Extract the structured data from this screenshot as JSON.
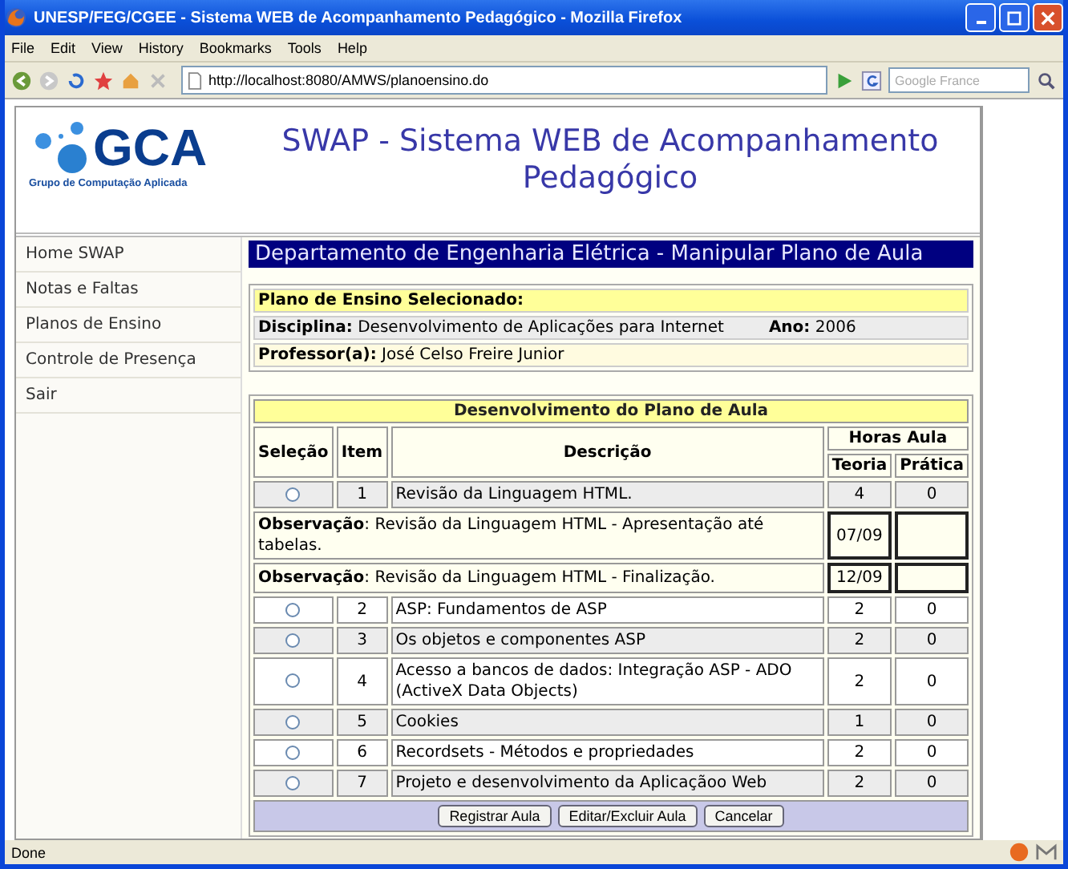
{
  "window": {
    "title": "UNESP/FEG/CGEE - Sistema WEB de Acompanhamento Pedagógico - Mozilla Firefox"
  },
  "menu": [
    "File",
    "Edit",
    "View",
    "History",
    "Bookmarks",
    "Tools",
    "Help"
  ],
  "toolbar": {
    "url": "http://localhost:8080/AMWS/planoensino.do",
    "search_placeholder": "Google France"
  },
  "header": {
    "logo_text": "GCA",
    "logo_subtitle": "Grupo de Computação Aplicada",
    "title": "SWAP - Sistema WEB de Acompanhamento Pedagógico"
  },
  "sidebar": {
    "items": [
      {
        "label": "Home SWAP",
        "selected": false
      },
      {
        "label": "Notas e Faltas",
        "selected": false
      },
      {
        "label": "Planos de Ensino",
        "selected": false
      },
      {
        "label": "Controle de Presença",
        "selected": false
      },
      {
        "label": "Sair",
        "selected": false
      }
    ]
  },
  "section_title": "Departamento de Engenharia Elétrica - Manipular Plano de Aula",
  "plan_info": {
    "title": "Plano de Ensino Selecionado:",
    "discipline_label": "Disciplina:",
    "discipline": "Desenvolvimento de Aplicações para Internet",
    "year_label": "Ano:",
    "year": "2006",
    "professor_label": "Professor(a):",
    "professor": "José Celso Freire Junior"
  },
  "table": {
    "title": "Desenvolvimento do Plano de Aula",
    "columns": {
      "selection": "Seleção",
      "item": "Item",
      "description": "Descrição",
      "hours": "Horas Aula",
      "theory": "Teoria",
      "practice": "Prática"
    },
    "rows": [
      {
        "kind": "item",
        "selected": false,
        "item": "1",
        "description": "Revisão da Linguagem HTML.",
        "theory": "4",
        "practice": "0"
      },
      {
        "kind": "observation",
        "text": "**Observação**: Revisão da Linguagem HTML - Apresentação até tabelas.",
        "date": "07/09"
      },
      {
        "kind": "observation",
        "text": "**Observação**: Revisão da Linguagem HTML - Finalização.",
        "date": "12/09"
      },
      {
        "kind": "item",
        "selected": false,
        "item": "2",
        "description": "ASP: Fundamentos de ASP",
        "theory": "2",
        "practice": "0"
      },
      {
        "kind": "item",
        "selected": false,
        "item": "3",
        "description": "Os objetos e componentes ASP",
        "theory": "2",
        "practice": "0"
      },
      {
        "kind": "item",
        "selected": false,
        "item": "4",
        "description": "Acesso a bancos de dados: Integração ASP - ADO (ActiveX Data Objects)",
        "theory": "2",
        "practice": "0"
      },
      {
        "kind": "item",
        "selected": false,
        "item": "5",
        "description": "Cookies",
        "theory": "1",
        "practice": "0"
      },
      {
        "kind": "item",
        "selected": false,
        "item": "6",
        "description": "Recordsets - Métodos e propriedades",
        "theory": "2",
        "practice": "0"
      },
      {
        "kind": "item",
        "selected": false,
        "item": "7",
        "description": "Projeto e desenvolvimento da Aplicaçãoo Web",
        "theory": "2",
        "practice": "0"
      }
    ],
    "buttons": [
      "Registrar Aula",
      "Editar/Excluir Aula",
      "Cancelar"
    ]
  },
  "status_bar": {
    "text": "Done"
  }
}
